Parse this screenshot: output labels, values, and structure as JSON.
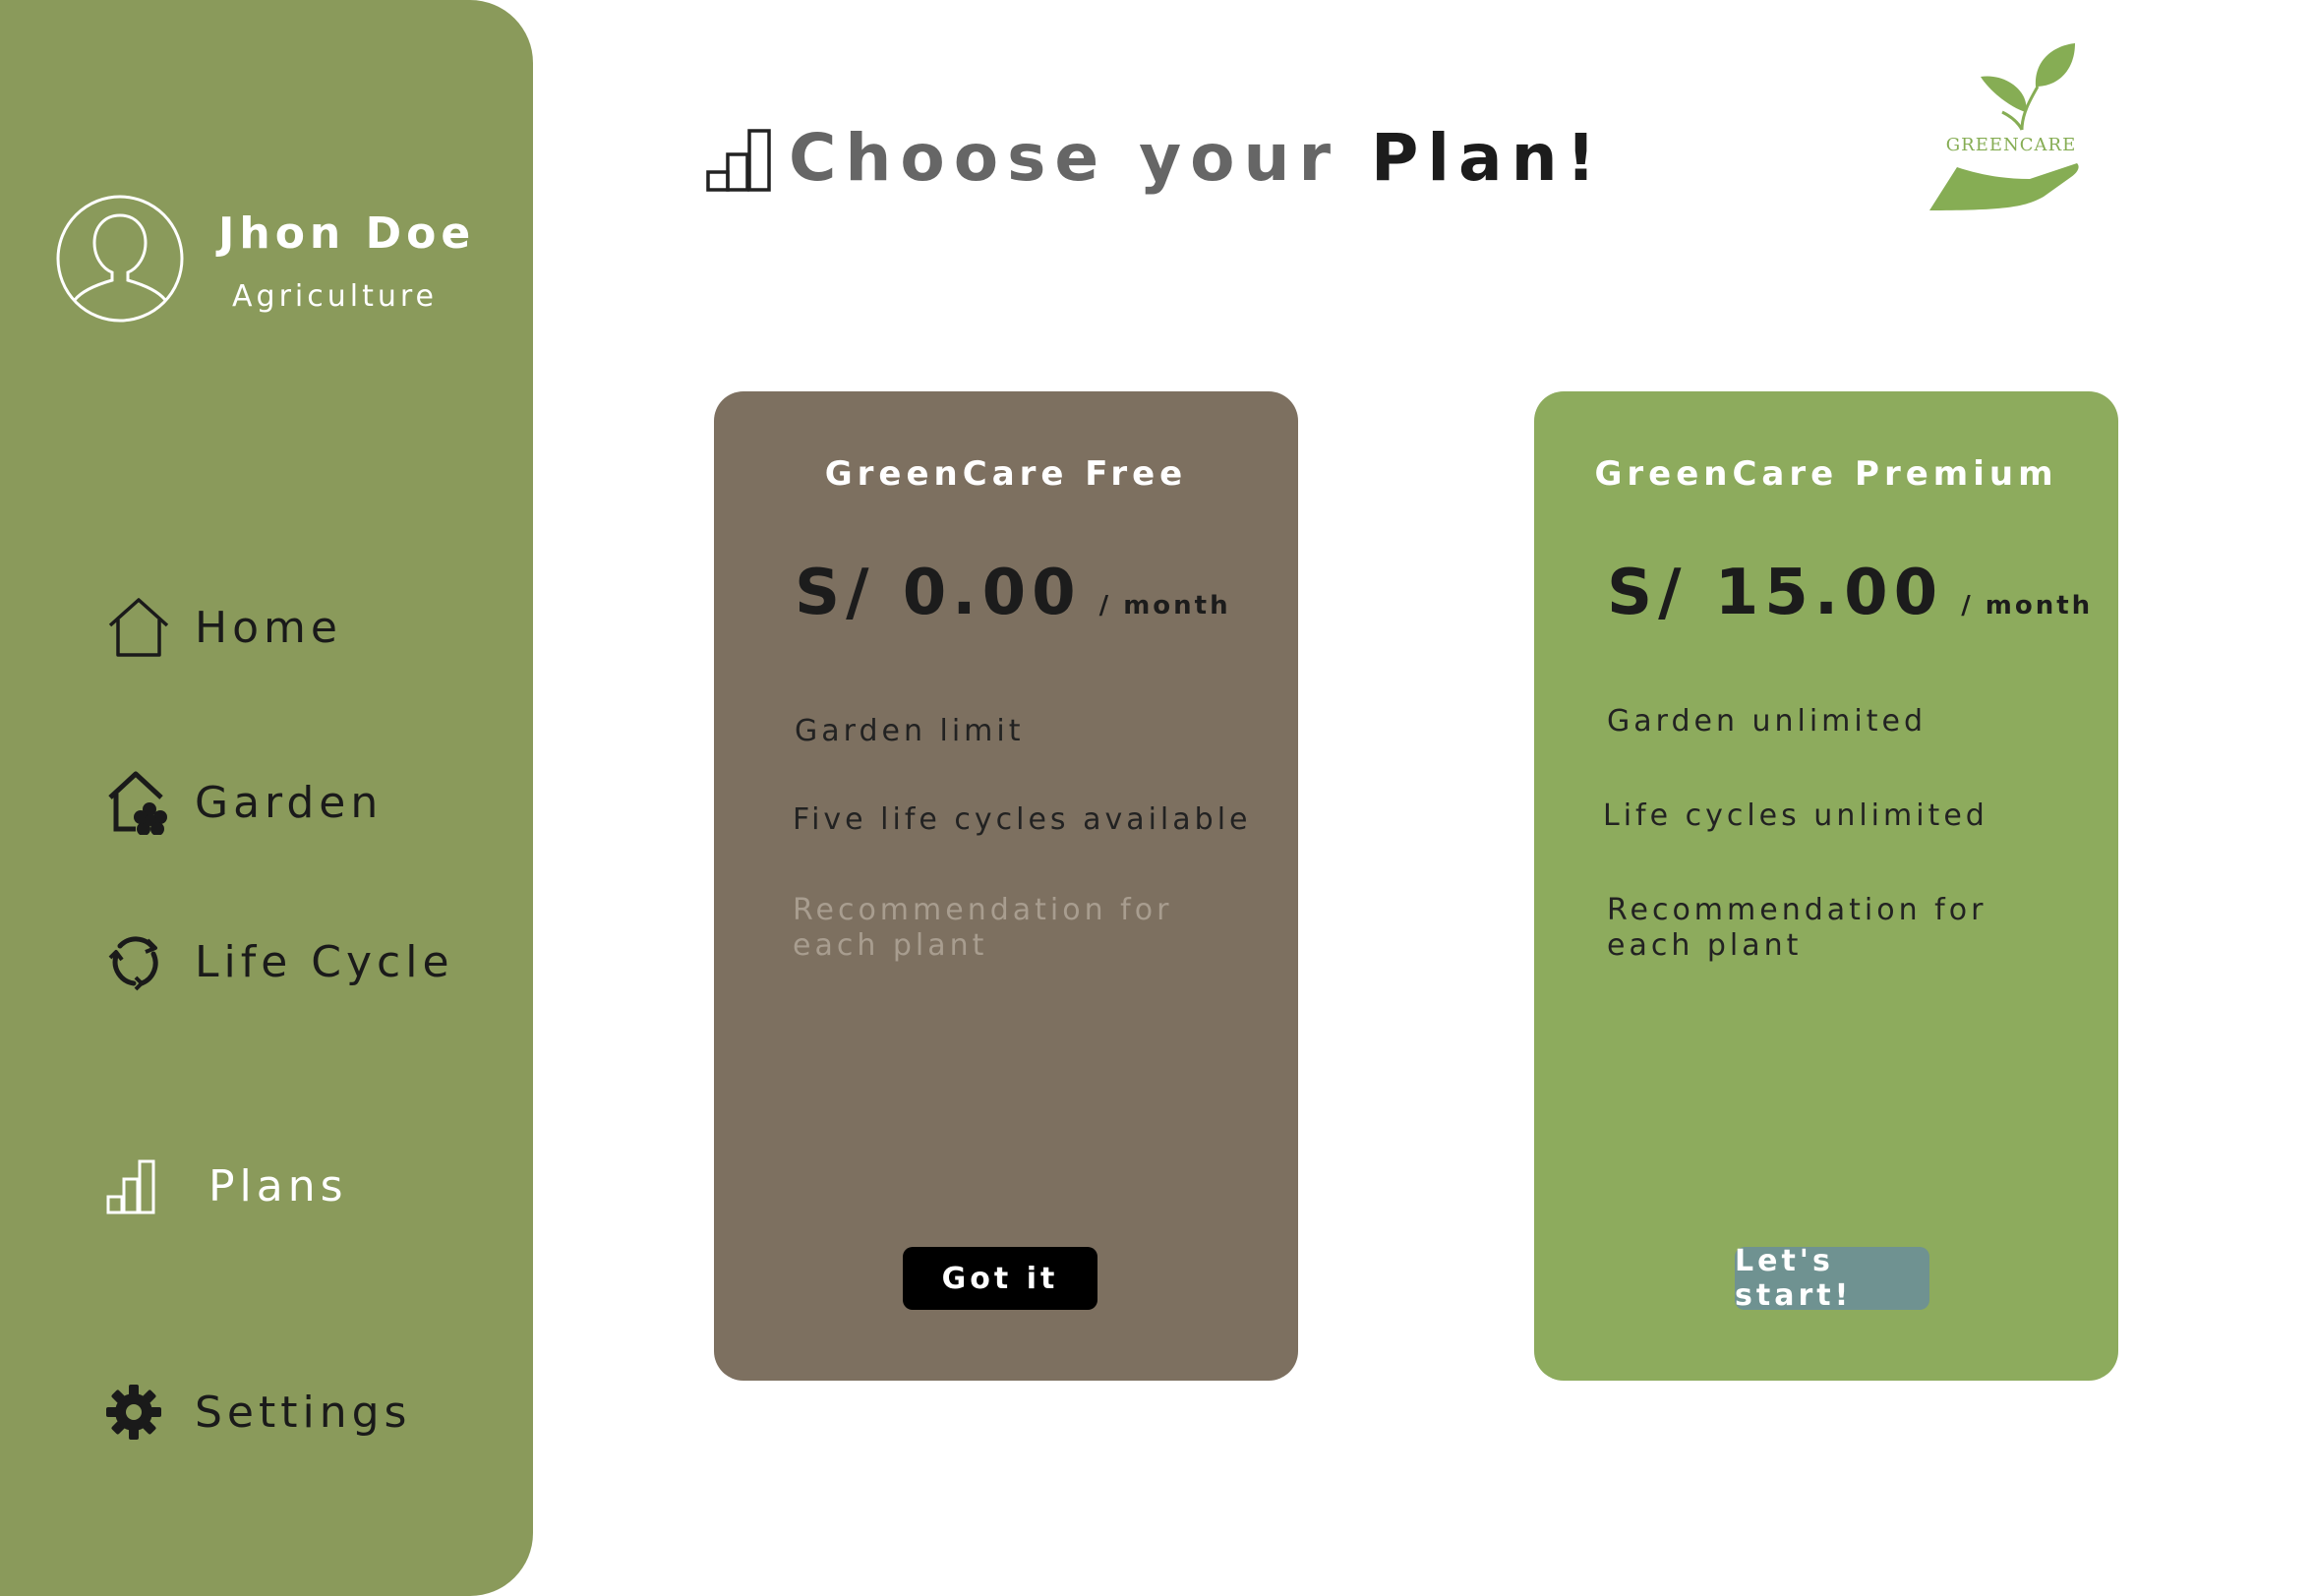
{
  "sidebar": {
    "user": {
      "name": "Jhon Doe",
      "role": "Agriculture",
      "avatar_icon": "user-avatar-icon"
    },
    "items": [
      {
        "label": "Home",
        "icon": "home-icon"
      },
      {
        "label": "Garden",
        "icon": "garden-house-icon"
      },
      {
        "label": "Life Cycle",
        "icon": "cycle-icon"
      },
      {
        "label": "Plans",
        "icon": "bar-chart-icon"
      },
      {
        "label": "Settings",
        "icon": "gear-icon"
      }
    ]
  },
  "header": {
    "title_part1": "Choose your",
    "title_part2": "Plan!",
    "title_icon": "bar-chart-icon",
    "logo_text": "GREENCARE"
  },
  "plans": [
    {
      "name": "GreenCare Free",
      "price": "S/ 0.00",
      "period": "/ month",
      "features": [
        "Garden limit",
        "Five life cycles available"
      ],
      "unavailable_features": [
        "Recommendation for each plant"
      ],
      "button_label": "Got it"
    },
    {
      "name": "GreenCare Premium",
      "price": "S/ 15.00",
      "period": "/ month",
      "features": [
        "Garden unlimited",
        "Life cycles unlimited",
        "Recommendation for each plant"
      ],
      "button_label": "Let's start!"
    }
  ],
  "colors": {
    "sidebar": "#8a9a5b",
    "free_card": "#7d7060",
    "premium_card": "#8dab5d",
    "premium_button": "#6f9291",
    "free_button": "#000000",
    "logo_green": "#86ad54"
  }
}
